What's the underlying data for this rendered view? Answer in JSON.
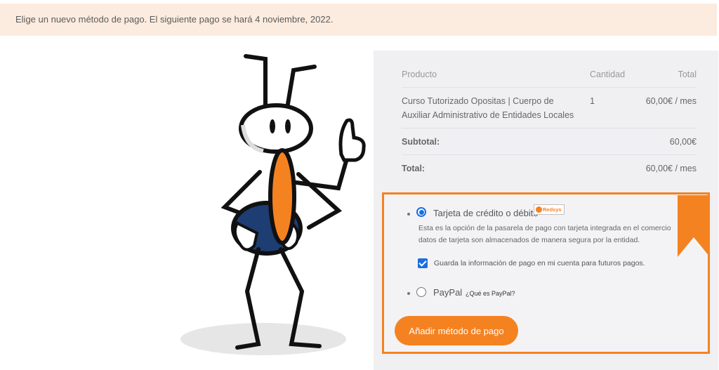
{
  "notice": {
    "text": "Elige un nuevo método de pago. El siguiente pago se hará 4 noviembre, 2022."
  },
  "order": {
    "headers": {
      "product": "Producto",
      "quantity": "Cantidad",
      "total": "Total"
    },
    "item": {
      "product": "Curso Tutorizado Opositas | Cuerpo de Auxiliar Administrativo de Entidades Locales",
      "quantity": "1",
      "price": "60,00€ / mes"
    },
    "subtotal": {
      "label": "Subtotal:",
      "value": "60,00€"
    },
    "total": {
      "label": "Total:",
      "value": "60,00€ / mes"
    }
  },
  "payment": {
    "card": {
      "label": "Tarjeta de crédito o débito",
      "badge": "Redsys",
      "description_line1": "Esta es la opción de la pasarela de pago con tarjeta integrada en el comercio",
      "description_line2": "datos de tarjeta son almacenados de manera segura por la entidad.",
      "selected": true
    },
    "save_info": {
      "label": "Guarda la información de pago en mi cuenta para futuros pagos.",
      "checked": true
    },
    "paypal": {
      "label": "PayPal",
      "link": "¿Qué es PayPal?",
      "selected": false
    },
    "submit_label": "Añadir método de pago"
  },
  "colors": {
    "accent": "#f58220",
    "notice_bg": "#fcecdf",
    "panel_bg": "#f0f0f3",
    "radio_blue": "#1a6fe0",
    "mascot_body": "#1d3d73"
  },
  "icons": {
    "mascot": "ant-mascot-thumbs-up",
    "ribbon": "bookmark-ribbon-icon",
    "redsys": "redsys-logo"
  }
}
